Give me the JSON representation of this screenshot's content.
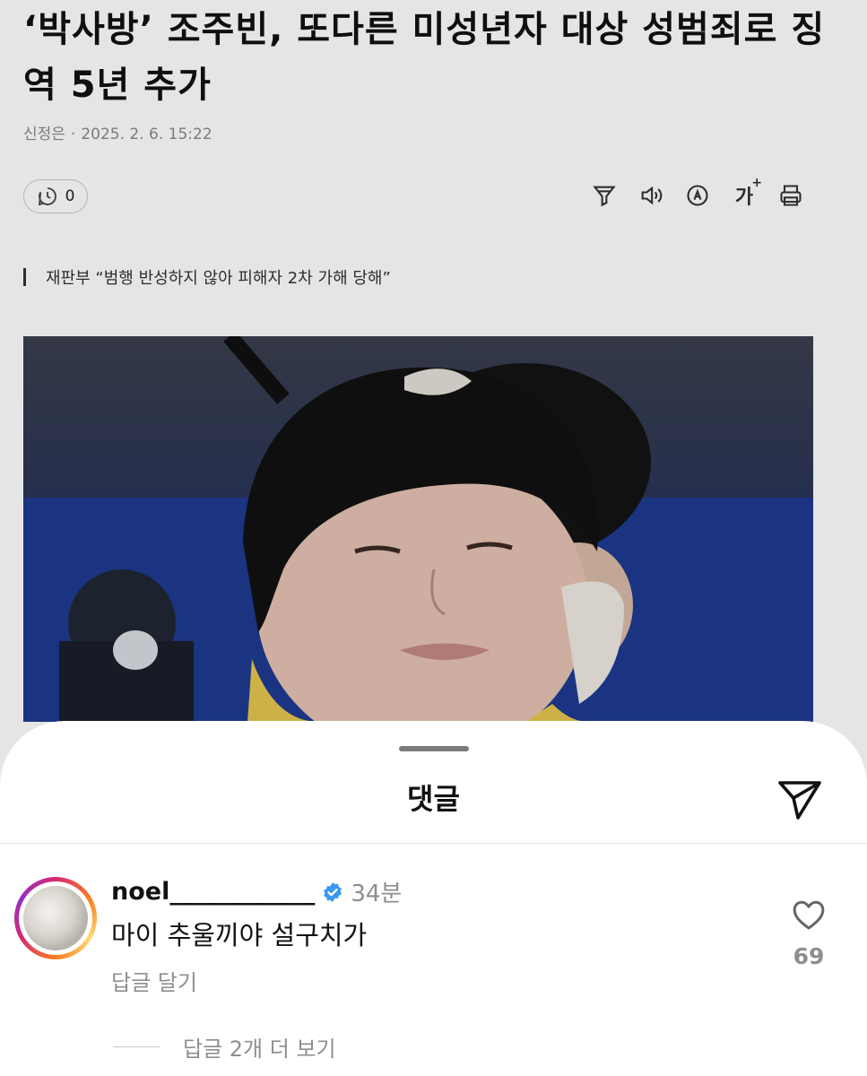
{
  "article": {
    "headline": "‘박사방’ 조주빈, 또다른 미성년자 대상 성범죄로 징역 5년 추가",
    "author": "신정은",
    "separator": "·",
    "datetime": "2025. 2. 6. 15:22",
    "comment_count": "0",
    "tools": {
      "font_size_label": "가",
      "font_size_plus": "+"
    },
    "subheading": "재판부 “범행 반성하지 않아 피해자 2차 가해 당해”",
    "photo_icon": "person-photo"
  },
  "sheet": {
    "title": "댓글",
    "comment": {
      "username": "noel____________",
      "time": "34분",
      "text": "마이 추울끼야 설구치가",
      "reply_label": "답글 달기",
      "like_count": "69",
      "more_replies_label": "답글 2개 더 보기"
    }
  },
  "colors": {
    "verified": "#3897f0",
    "muted_text": "#8e8e8e",
    "ring_gradient": [
      "#d62976",
      "#fa7e1e",
      "#feda75",
      "#962fbf"
    ]
  }
}
